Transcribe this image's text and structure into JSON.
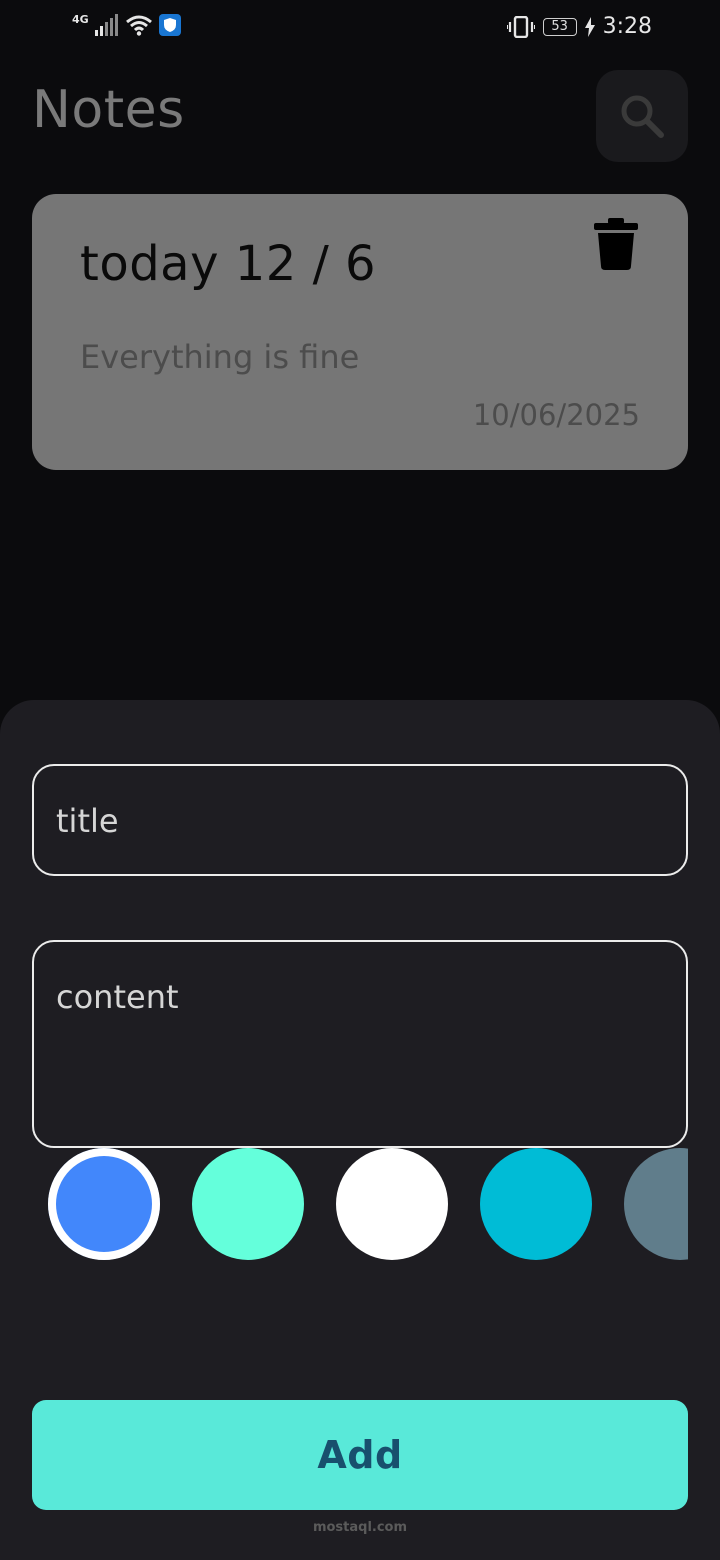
{
  "status_bar": {
    "network": "4G",
    "battery": "53",
    "time": "3:28"
  },
  "header": {
    "title": "Notes",
    "search_icon": "search-icon"
  },
  "notes": [
    {
      "title": "today 12 / 6",
      "content": "Everything is fine",
      "date": "10/06/2025",
      "delete_icon": "trash-icon"
    }
  ],
  "form": {
    "title_placeholder": "title",
    "content_placeholder": "content",
    "colors": [
      "#4287fb",
      "#64ffdb",
      "#ffffff",
      "#00bcd6",
      "#607d8b"
    ],
    "selected_color_index": 0,
    "add_label": "Add"
  },
  "watermark": "mostaql.com",
  "theme": {
    "background": "#0b0b0d",
    "card": "#767676",
    "sheet": "#1e1d22",
    "accent": "#59e9d9"
  }
}
